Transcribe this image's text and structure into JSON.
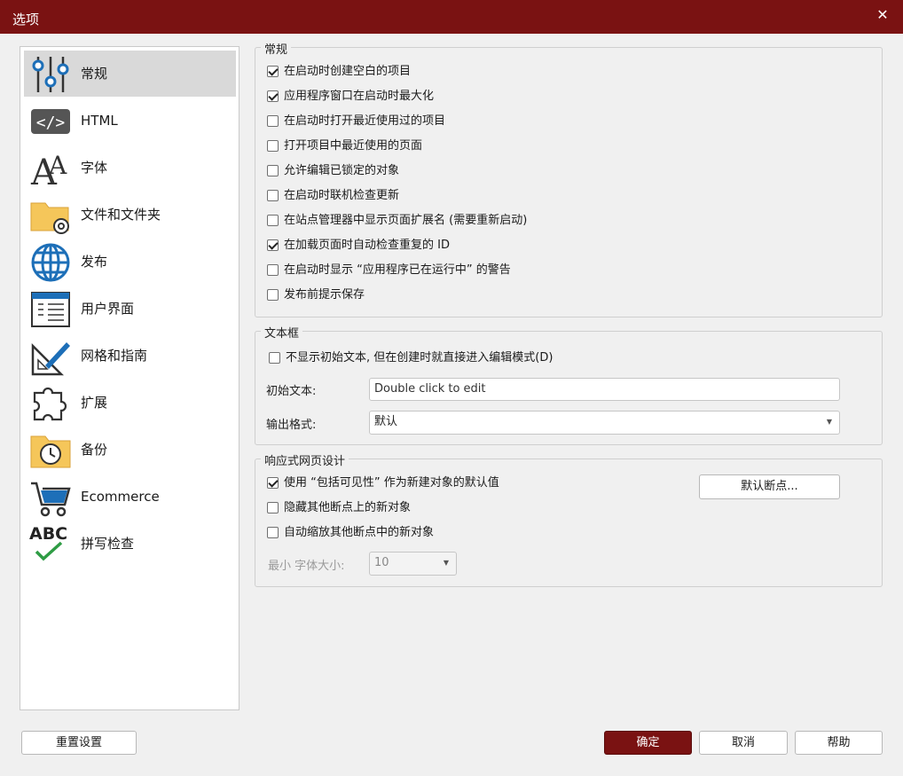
{
  "window": {
    "title": "选项",
    "close_icon": "close-icon"
  },
  "sidebar": {
    "items": [
      {
        "label": "常规",
        "icon": "sliders-icon",
        "active": true
      },
      {
        "label": "HTML",
        "icon": "code-icon"
      },
      {
        "label": "字体",
        "icon": "font-icon"
      },
      {
        "label": "文件和文件夹",
        "icon": "folder-gear-icon"
      },
      {
        "label": "发布",
        "icon": "globe-icon"
      },
      {
        "label": "用户界面",
        "icon": "window-icon"
      },
      {
        "label": "网格和指南",
        "icon": "ruler-pencil-icon"
      },
      {
        "label": "扩展",
        "icon": "puzzle-icon"
      },
      {
        "label": "备份",
        "icon": "folder-clock-icon"
      },
      {
        "label": "Ecommerce",
        "icon": "cart-icon"
      },
      {
        "label": "拼写检查",
        "icon": "spellcheck-icon"
      }
    ]
  },
  "general": {
    "title": "常规",
    "options": [
      {
        "label": "在启动时创建空白的项目",
        "checked": true
      },
      {
        "label": "应用程序窗口在启动时最大化",
        "checked": true
      },
      {
        "label": "在启动时打开最近使用过的项目",
        "checked": false
      },
      {
        "label": "打开项目中最近使用的页面",
        "checked": false
      },
      {
        "label": "允许编辑已锁定的对象",
        "checked": false
      },
      {
        "label": "在启动时联机检查更新",
        "checked": false
      },
      {
        "label": "在站点管理器中显示页面扩展名 (需要重新启动)",
        "checked": false
      },
      {
        "label": "在加载页面时自动检查重复的 ID",
        "checked": true
      },
      {
        "label": "在启动时显示 “应用程序已在运行中” 的警告",
        "checked": false
      },
      {
        "label": "发布前提示保存",
        "checked": false
      }
    ]
  },
  "textbox": {
    "title": "文本框",
    "option": {
      "label": "不显示初始文本, 但在创建时就直接进入编辑模式(D)",
      "checked": false
    },
    "initial_text_label": "初始文本:",
    "initial_text_value": "Double click to edit",
    "output_format_label": "输出格式:",
    "output_format_value": "默认"
  },
  "responsive": {
    "title": "响应式网页设计",
    "options": [
      {
        "label": "使用 “包括可见性” 作为新建对象的默认值",
        "checked": true
      },
      {
        "label": "隐藏其他断点上的新对象",
        "checked": false
      },
      {
        "label": "自动缩放其他断点中的新对象",
        "checked": false
      }
    ],
    "default_breakpoint_button": "默认断点...",
    "min_font_label": "最小 字体大小:",
    "min_font_value": "10"
  },
  "footer": {
    "reset": "重置设置",
    "ok": "确定",
    "cancel": "取消",
    "help": "帮助"
  },
  "colors": {
    "titlebar": "#7a1212",
    "accent": "#7a1212",
    "icon_blue": "#1d6fb8"
  }
}
